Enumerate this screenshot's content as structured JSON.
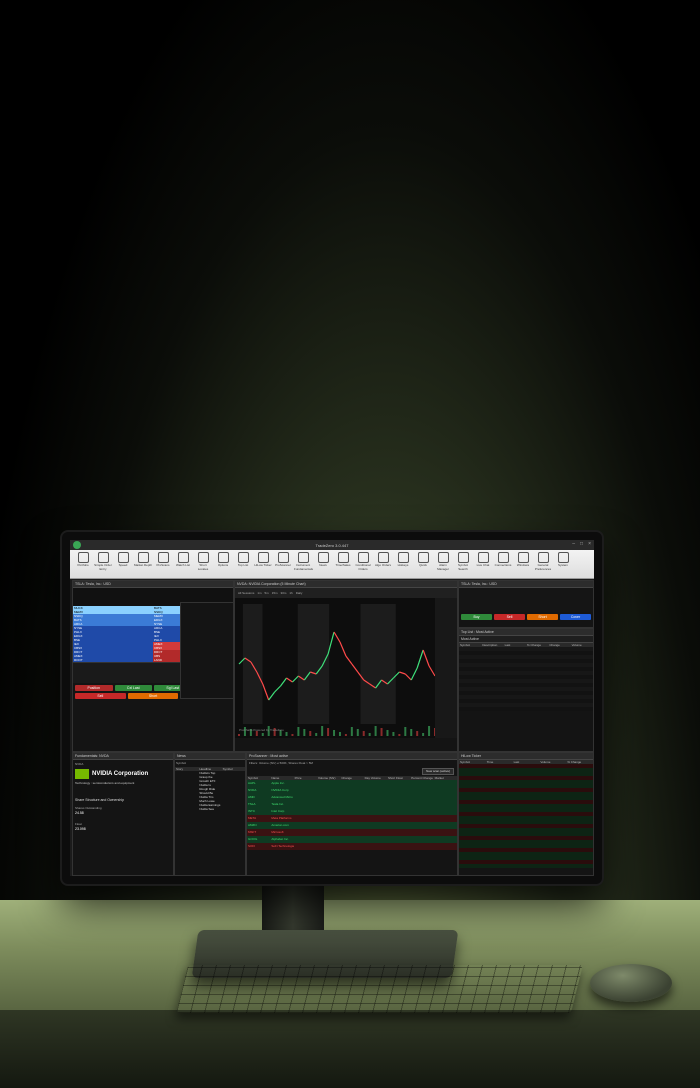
{
  "app": {
    "title": "TradeZero 3.0.447"
  },
  "toolbar": [
    {
      "label": "Portfolio",
      "icon": "briefcase-icon"
    },
    {
      "label": "Simple Order Entry",
      "icon": "order-entry-icon"
    },
    {
      "label": "Speed",
      "icon": "bolt-icon"
    },
    {
      "label": "Market Depth",
      "icon": "depth-icon"
    },
    {
      "label": "ProScans",
      "icon": "scan-icon"
    },
    {
      "label": "Watch List",
      "icon": "star-icon"
    },
    {
      "label": "Short Locates",
      "icon": "pin-icon"
    },
    {
      "label": "Options",
      "icon": "options-icon"
    },
    {
      "label": "Top List",
      "icon": "toplist-icon"
    },
    {
      "label": "HiLow Ticker",
      "icon": "hilow-icon"
    },
    {
      "label": "ProScanner",
      "icon": "scanner-icon"
    },
    {
      "label": "Instrument Fundamentals",
      "icon": "magnifier-icon"
    },
    {
      "label": "News",
      "icon": "news-icon"
    },
    {
      "label": "Time/Sales",
      "icon": "clock-icon"
    },
    {
      "label": "Conditional Orders",
      "icon": "conditional-icon"
    },
    {
      "label": "Algo Orders",
      "icon": "algo-icon"
    },
    {
      "label": "Hotkeys",
      "icon": "keyboard-icon"
    },
    {
      "label": "Quick",
      "icon": "quick-icon"
    },
    {
      "label": "Alarm Manager",
      "icon": "bell-icon"
    },
    {
      "label": "Symbol Search",
      "icon": "search-icon"
    },
    {
      "label": "Live Chat",
      "icon": "chat-icon"
    },
    {
      "label": "Connections",
      "icon": "connections-icon"
    },
    {
      "label": "Windows",
      "icon": "windows-icon"
    },
    {
      "label": "General Preferences",
      "icon": "preferences-icon"
    },
    {
      "label": "System",
      "icon": "system-icon"
    }
  ],
  "depth": {
    "title": "TSLA: Tesla, Inc.: USD",
    "bids": [
      "MUCK",
      "MEMX",
      "NSDQ",
      "BATS",
      "ARCA",
      "NYSE",
      "PHLX",
      "EDGX",
      "BSE",
      "IEX",
      "CBSX",
      "DRCT",
      "AMEX",
      "ROOT"
    ],
    "asks": [
      "BATS",
      "NSDQ",
      "MEMX",
      "EDGX",
      "NYSE",
      "ARCA",
      "BSE",
      "IEX",
      "PHLX",
      "AMEX",
      "CBSX",
      "DRCT",
      "UBS",
      "LAND"
    ],
    "buttons": [
      {
        "label": "Position",
        "color": "#b22a2a"
      },
      {
        "label": "Cxl Last",
        "color": "#2f8a3a"
      },
      {
        "label": "Sgl Last",
        "color": "#2f8a3a"
      },
      {
        "label": "Buy",
        "color": "#2f8a3a"
      },
      {
        "label": "Sell",
        "color": "#c62828"
      },
      {
        "label": "Short",
        "color": "#e06a00"
      },
      {
        "label": "Cover",
        "color": "#1e5bd6"
      }
    ]
  },
  "chart": {
    "title": "NVDA: NVIDIA Corporation (5 Minute Chart)",
    "session": "All Sessions",
    "periods": [
      "1m",
      "5m",
      "15m",
      "30m",
      "1h",
      "Daily"
    ],
    "chart_data": {
      "type": "line",
      "series": [
        {
          "values": [
            4.0,
            4.3,
            4.1,
            3.6,
            3.0,
            2.2,
            2.6,
            2.9,
            3.3,
            3.1,
            3.4,
            3.2,
            3.6,
            3.5,
            3.9,
            4.5,
            5.6,
            5.1,
            4.4,
            4.0,
            3.6,
            3.2,
            3.0,
            2.8,
            3.2,
            3.0,
            3.3,
            3.6,
            3.5,
            3.2,
            3.8,
            4.7,
            3.9,
            3.4
          ]
        }
      ],
      "ylim": [
        1,
        7
      ]
    },
    "watermark": "ProCharts Powered by TradeZero"
  },
  "order_entry": {
    "title": "TSLA: Tesla, Inc.: USD",
    "buttons": [
      {
        "label": "Buy",
        "color": "#2f8a3a"
      },
      {
        "label": "Sell",
        "color": "#c62828"
      },
      {
        "label": "Short",
        "color": "#e06a00"
      },
      {
        "label": "Cover",
        "color": "#1e5bd6"
      }
    ]
  },
  "toplist": {
    "title": "Top List : Most Active",
    "header": "Most Active",
    "columns": [
      "Symbol",
      "Description",
      "Last",
      "% Change",
      "Change",
      "Volume"
    ]
  },
  "fundamentals": {
    "title": "Fundamentals: NVDA",
    "symbol": "NVDA",
    "company": "NVIDIA Corporation",
    "sector": "Technology : semiconductors and equipment",
    "section": "Share Structure and Ownership",
    "shares_label": "Shares Outstanding",
    "shares_value": "24.58",
    "float_label": "Float",
    "float_value": "23.098"
  },
  "news": {
    "title": "News",
    "symbol_label": "Symbol",
    "columns": [
      "Story",
      "Headline",
      "Symbol"
    ],
    "symbol_col": "NDAQ",
    "headlines": [
      "Nvidia's Top",
      "Grasp the",
      "Growth ETF",
      "Nvidia Is",
      "Rough Ride",
      "Should Be",
      "Nvidia Tim",
      "Much Lowe",
      "Nvidia Earnings",
      "Nvidia Sea"
    ]
  },
  "proscanner": {
    "title": "ProScanner : Most active",
    "subtitle": "Filters: Volume (Shr) ≥ 500K, Shares Float > 5M",
    "button": "New scan (active)",
    "columns": [
      "Symbol",
      "Name",
      "Price",
      "Volume (Shr)",
      "Change",
      "Day Volume",
      "Short Float",
      "Percent Change",
      "Market"
    ],
    "rows": [
      {
        "symbol": "AAPL",
        "name": "Apple Inc.",
        "tone": "green"
      },
      {
        "symbol": "NVDA",
        "name": "NVIDIA Corp",
        "tone": "green"
      },
      {
        "symbol": "AMD",
        "name": "Advanced Micro",
        "tone": "green"
      },
      {
        "symbol": "TSLA",
        "name": "Tesla Inc.",
        "tone": "green"
      },
      {
        "symbol": "INTC",
        "name": "Intel Corp",
        "tone": "green"
      },
      {
        "symbol": "META",
        "name": "Meta Platforms",
        "tone": "red"
      },
      {
        "symbol": "AMZN",
        "name": "Amazon.com",
        "tone": "green"
      },
      {
        "symbol": "MSFT",
        "name": "Microsoft",
        "tone": "red"
      },
      {
        "symbol": "GOOG",
        "name": "Alphabet Inc.",
        "tone": "green"
      },
      {
        "symbol": "SOFI",
        "name": "SoFi Technologies",
        "tone": "red"
      }
    ]
  },
  "hilow": {
    "title": "HiLow Ticker",
    "columns": [
      "Symbol",
      "Time",
      "Last",
      "Volume",
      "% Change"
    ]
  }
}
